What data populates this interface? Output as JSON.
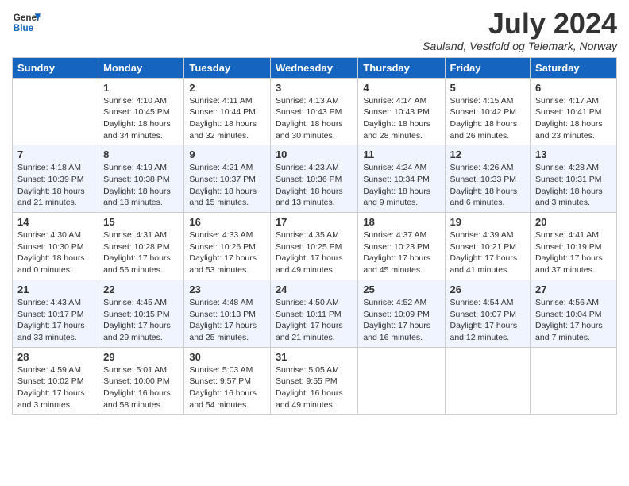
{
  "header": {
    "logo_general": "General",
    "logo_blue": "Blue",
    "month_title": "July 2024",
    "subtitle": "Sauland, Vestfold og Telemark, Norway"
  },
  "calendar": {
    "days_of_week": [
      "Sunday",
      "Monday",
      "Tuesday",
      "Wednesday",
      "Thursday",
      "Friday",
      "Saturday"
    ],
    "weeks": [
      [
        {
          "day": "",
          "info": ""
        },
        {
          "day": "1",
          "info": "Sunrise: 4:10 AM\nSunset: 10:45 PM\nDaylight: 18 hours\nand 34 minutes."
        },
        {
          "day": "2",
          "info": "Sunrise: 4:11 AM\nSunset: 10:44 PM\nDaylight: 18 hours\nand 32 minutes."
        },
        {
          "day": "3",
          "info": "Sunrise: 4:13 AM\nSunset: 10:43 PM\nDaylight: 18 hours\nand 30 minutes."
        },
        {
          "day": "4",
          "info": "Sunrise: 4:14 AM\nSunset: 10:43 PM\nDaylight: 18 hours\nand 28 minutes."
        },
        {
          "day": "5",
          "info": "Sunrise: 4:15 AM\nSunset: 10:42 PM\nDaylight: 18 hours\nand 26 minutes."
        },
        {
          "day": "6",
          "info": "Sunrise: 4:17 AM\nSunset: 10:41 PM\nDaylight: 18 hours\nand 23 minutes."
        }
      ],
      [
        {
          "day": "7",
          "info": "Sunrise: 4:18 AM\nSunset: 10:39 PM\nDaylight: 18 hours\nand 21 minutes."
        },
        {
          "day": "8",
          "info": "Sunrise: 4:19 AM\nSunset: 10:38 PM\nDaylight: 18 hours\nand 18 minutes."
        },
        {
          "day": "9",
          "info": "Sunrise: 4:21 AM\nSunset: 10:37 PM\nDaylight: 18 hours\nand 15 minutes."
        },
        {
          "day": "10",
          "info": "Sunrise: 4:23 AM\nSunset: 10:36 PM\nDaylight: 18 hours\nand 13 minutes."
        },
        {
          "day": "11",
          "info": "Sunrise: 4:24 AM\nSunset: 10:34 PM\nDaylight: 18 hours\nand 9 minutes."
        },
        {
          "day": "12",
          "info": "Sunrise: 4:26 AM\nSunset: 10:33 PM\nDaylight: 18 hours\nand 6 minutes."
        },
        {
          "day": "13",
          "info": "Sunrise: 4:28 AM\nSunset: 10:31 PM\nDaylight: 18 hours\nand 3 minutes."
        }
      ],
      [
        {
          "day": "14",
          "info": "Sunrise: 4:30 AM\nSunset: 10:30 PM\nDaylight: 18 hours\nand 0 minutes."
        },
        {
          "day": "15",
          "info": "Sunrise: 4:31 AM\nSunset: 10:28 PM\nDaylight: 17 hours\nand 56 minutes."
        },
        {
          "day": "16",
          "info": "Sunrise: 4:33 AM\nSunset: 10:26 PM\nDaylight: 17 hours\nand 53 minutes."
        },
        {
          "day": "17",
          "info": "Sunrise: 4:35 AM\nSunset: 10:25 PM\nDaylight: 17 hours\nand 49 minutes."
        },
        {
          "day": "18",
          "info": "Sunrise: 4:37 AM\nSunset: 10:23 PM\nDaylight: 17 hours\nand 45 minutes."
        },
        {
          "day": "19",
          "info": "Sunrise: 4:39 AM\nSunset: 10:21 PM\nDaylight: 17 hours\nand 41 minutes."
        },
        {
          "day": "20",
          "info": "Sunrise: 4:41 AM\nSunset: 10:19 PM\nDaylight: 17 hours\nand 37 minutes."
        }
      ],
      [
        {
          "day": "21",
          "info": "Sunrise: 4:43 AM\nSunset: 10:17 PM\nDaylight: 17 hours\nand 33 minutes."
        },
        {
          "day": "22",
          "info": "Sunrise: 4:45 AM\nSunset: 10:15 PM\nDaylight: 17 hours\nand 29 minutes."
        },
        {
          "day": "23",
          "info": "Sunrise: 4:48 AM\nSunset: 10:13 PM\nDaylight: 17 hours\nand 25 minutes."
        },
        {
          "day": "24",
          "info": "Sunrise: 4:50 AM\nSunset: 10:11 PM\nDaylight: 17 hours\nand 21 minutes."
        },
        {
          "day": "25",
          "info": "Sunrise: 4:52 AM\nSunset: 10:09 PM\nDaylight: 17 hours\nand 16 minutes."
        },
        {
          "day": "26",
          "info": "Sunrise: 4:54 AM\nSunset: 10:07 PM\nDaylight: 17 hours\nand 12 minutes."
        },
        {
          "day": "27",
          "info": "Sunrise: 4:56 AM\nSunset: 10:04 PM\nDaylight: 17 hours\nand 7 minutes."
        }
      ],
      [
        {
          "day": "28",
          "info": "Sunrise: 4:59 AM\nSunset: 10:02 PM\nDaylight: 17 hours\nand 3 minutes."
        },
        {
          "day": "29",
          "info": "Sunrise: 5:01 AM\nSunset: 10:00 PM\nDaylight: 16 hours\nand 58 minutes."
        },
        {
          "day": "30",
          "info": "Sunrise: 5:03 AM\nSunset: 9:57 PM\nDaylight: 16 hours\nand 54 minutes."
        },
        {
          "day": "31",
          "info": "Sunrise: 5:05 AM\nSunset: 9:55 PM\nDaylight: 16 hours\nand 49 minutes."
        },
        {
          "day": "",
          "info": ""
        },
        {
          "day": "",
          "info": ""
        },
        {
          "day": "",
          "info": ""
        }
      ]
    ]
  }
}
